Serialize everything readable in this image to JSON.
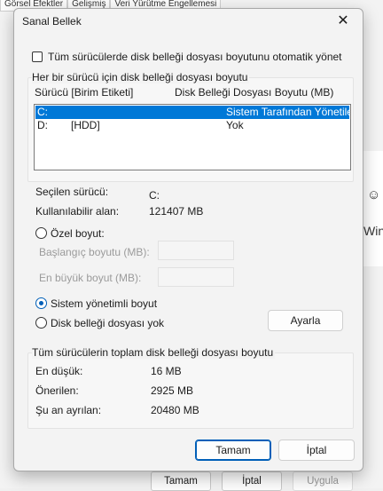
{
  "background": {
    "tabs": [
      "Görsel Efektler",
      "Gelişmiş",
      "Veri Yürütme Engellemesi"
    ],
    "side_text": "Wind",
    "buttons": {
      "ok": "Tamam",
      "cancel": "İptal",
      "apply": "Uygula"
    }
  },
  "dialog": {
    "title": "Sanal Bellek",
    "auto_manage_label": "Tüm sürücülerde disk belleği dosyası boyutunu otomatik yönet",
    "auto_manage_checked": false,
    "per_drive_group_title": "Her bir sürücü için disk belleği dosyası boyutu",
    "list": {
      "headers": [
        "Sürücü  [Birim Etiketi]",
        "Disk Belleği Dosyası Boyutu (MB)"
      ],
      "rows": [
        {
          "drive": "C:",
          "label": "",
          "size": "Sistem Tarafından Yönetilen",
          "selected": true
        },
        {
          "drive": "D:",
          "label": "[HDD]",
          "size": "Yok",
          "selected": false
        }
      ]
    },
    "selected_drive_label": "Seçilen sürücü:",
    "selected_drive_value": "C:",
    "available_space_label": "Kullanılabilir alan:",
    "available_space_value": "121407 MB",
    "custom_size_label": "Özel boyut:",
    "initial_size_label": "Başlangıç boyutu (MB):",
    "max_size_label": "En büyük boyut (MB):",
    "initial_size_value": "",
    "max_size_value": "",
    "system_managed_label": "Sistem yönetimli boyut",
    "no_paging_label": "Disk belleği dosyası yok",
    "selected_option": "system_managed",
    "set_button": "Ayarla",
    "total_group_title": "Tüm sürücülerin toplam disk belleği dosyası boyutu",
    "minimum_label": "En düşük:",
    "minimum_value": "16 MB",
    "recommended_label": "Önerilen:",
    "recommended_value": "2925 MB",
    "current_label": "Şu an ayrılan:",
    "current_value": "20480 MB",
    "ok_button": "Tamam",
    "cancel_button": "İptal"
  }
}
